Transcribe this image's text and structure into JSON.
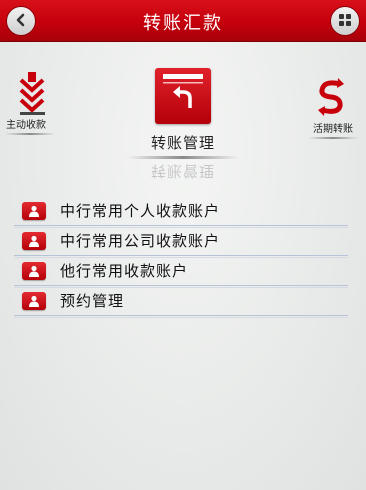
{
  "header": {
    "title": "转账汇款",
    "back_icon": "back-arrow-icon",
    "menu_icon": "grid-menu-icon",
    "accent_color": "#c5000c"
  },
  "carousel": {
    "left": {
      "label": "主动收款",
      "icon": "download-arrows-icon"
    },
    "center": {
      "label": "转账管理",
      "icon": "transfer-folder-icon"
    },
    "right": {
      "label": "活期转账",
      "icon": "currency-cycle-icon"
    }
  },
  "menu": {
    "items": [
      {
        "label": "中行常用个人收款账户",
        "icon": "person-icon"
      },
      {
        "label": "中行常用公司收款账户",
        "icon": "person-icon"
      },
      {
        "label": "他行常用收款账户",
        "icon": "person-icon"
      },
      {
        "label": "预约管理",
        "icon": "person-icon"
      }
    ]
  }
}
